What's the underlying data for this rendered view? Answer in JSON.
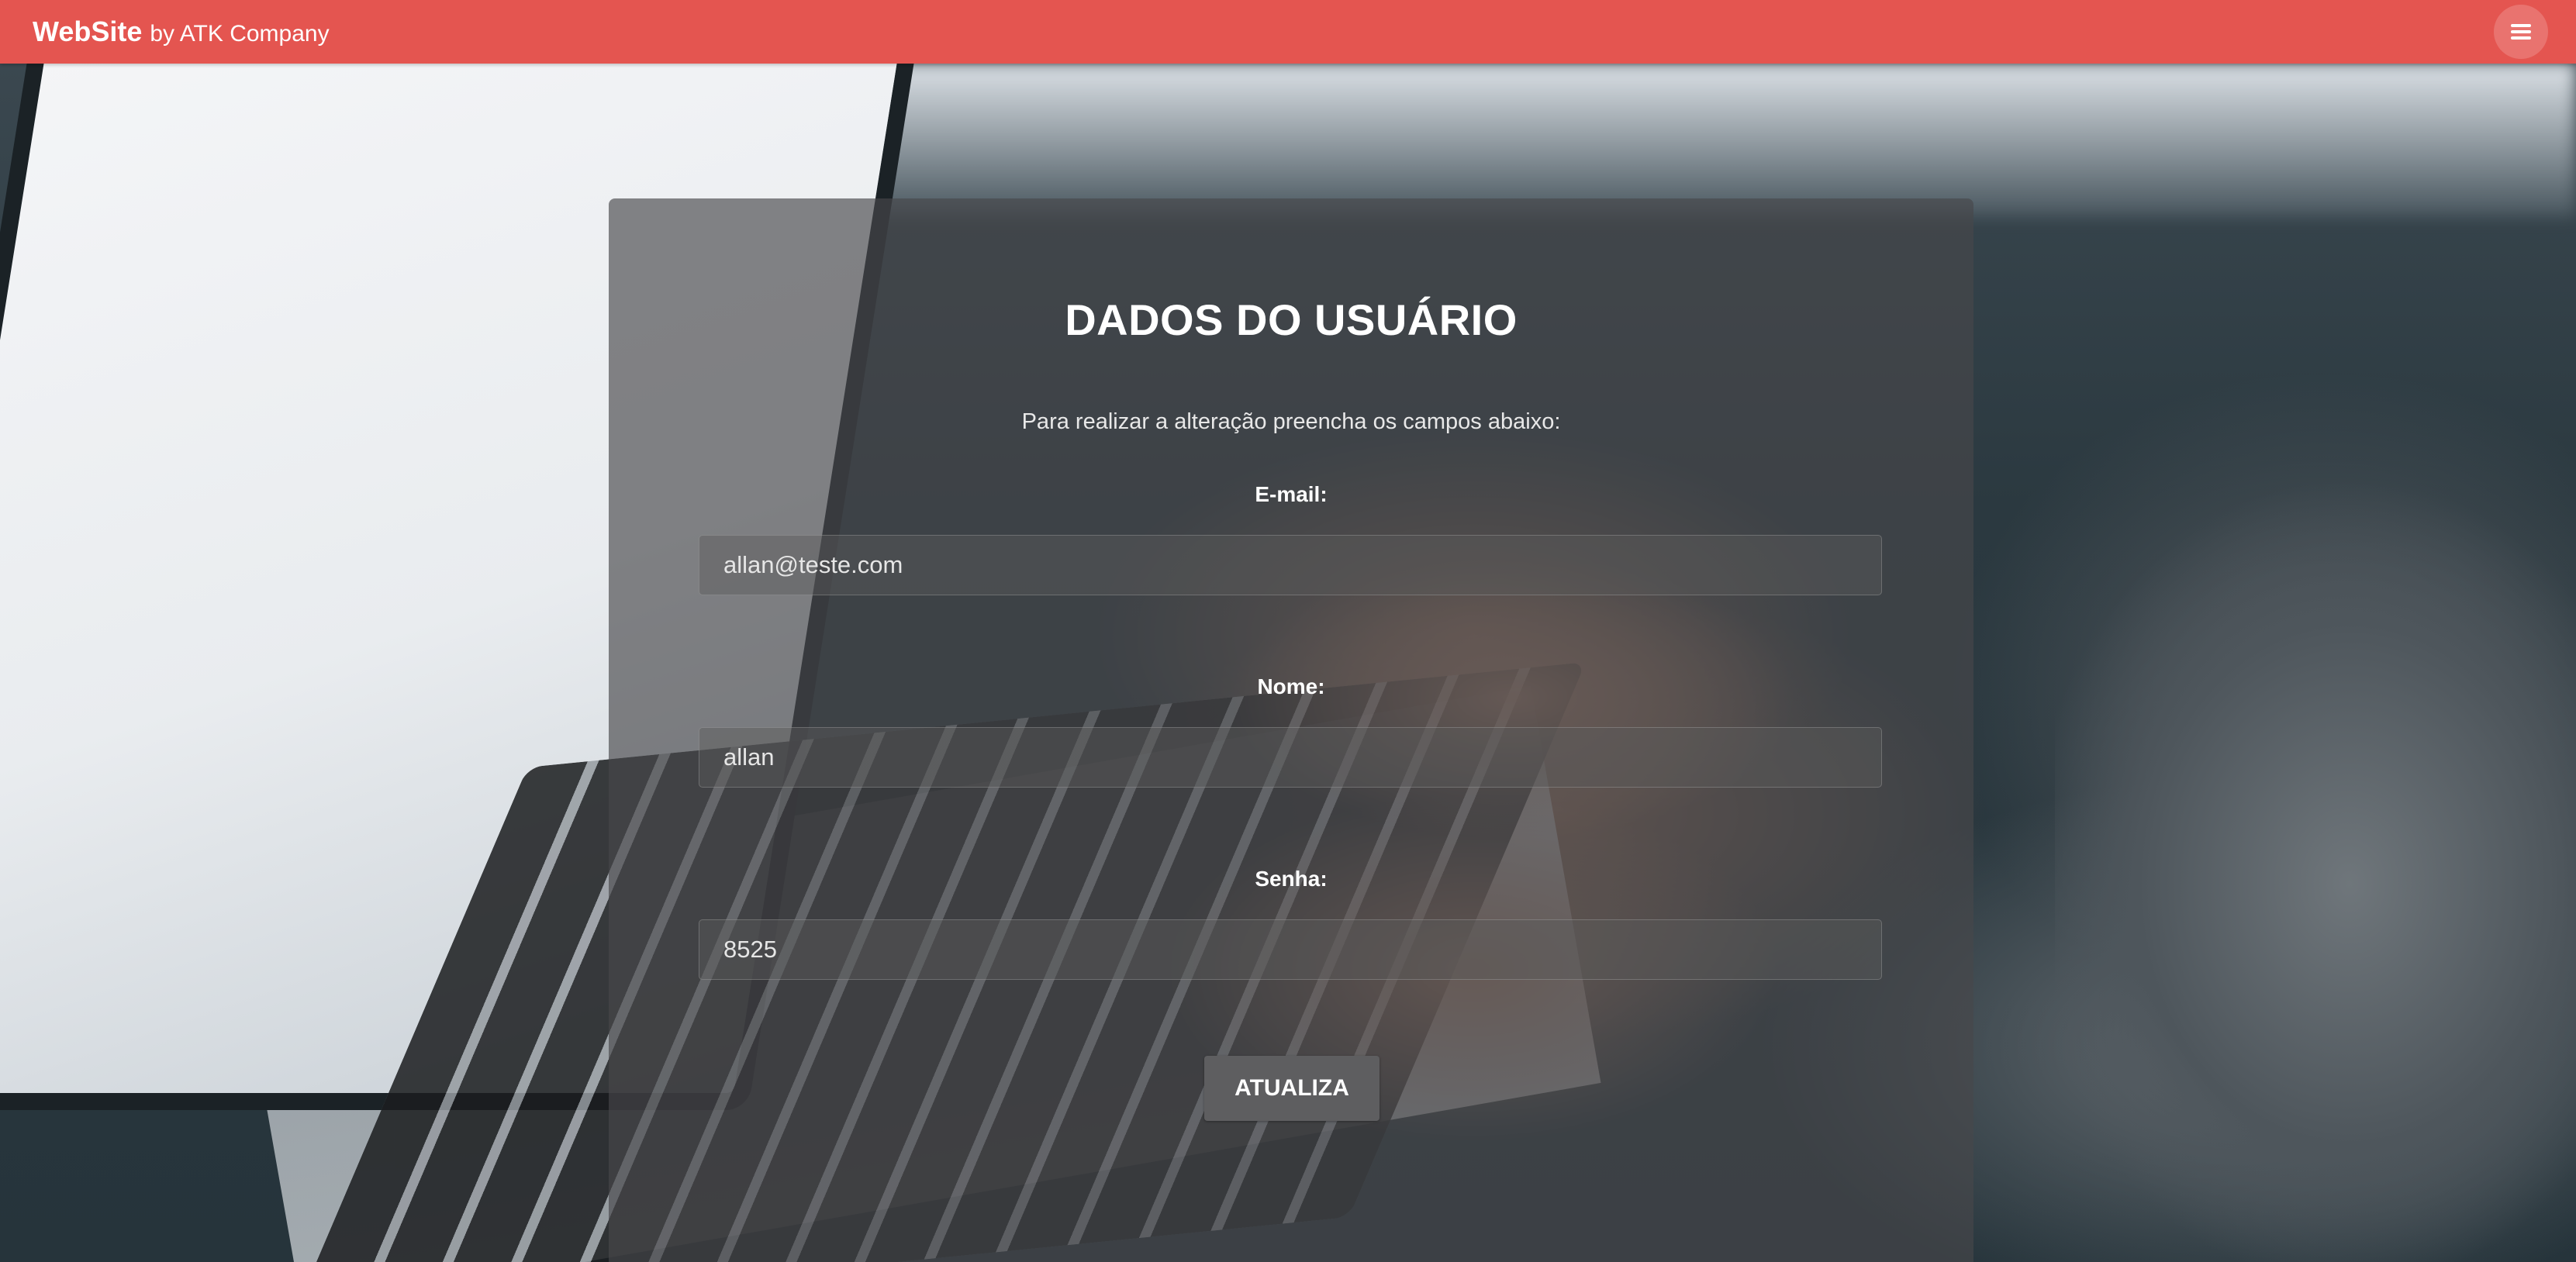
{
  "navbar": {
    "brand_main": "WebSite",
    "brand_sub": "by ATK Company",
    "menu_icon": "hamburger-menu-icon",
    "color": "#e45550"
  },
  "form": {
    "title": "DADOS DO USUÁRIO",
    "subtitle": "Para realizar a alteração preencha os campos abaixo:",
    "email_label": "E-mail:",
    "email_value": "allan@teste.com",
    "name_label": "Nome:",
    "name_value": "allan",
    "password_label": "Senha:",
    "password_value": "8525",
    "submit_label": "ATUALIZA"
  }
}
